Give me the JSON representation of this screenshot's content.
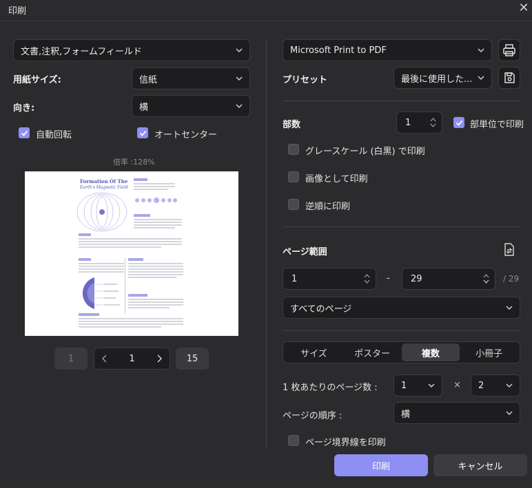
{
  "window": {
    "title": "印刷"
  },
  "left": {
    "content_select": "文書,注釈,フォームフィールド",
    "paper_size_label": "用紙サイズ:",
    "paper_size_value": "信紙",
    "orientation_label": "向き:",
    "orientation_value": "横",
    "auto_rotate_label": "自動回転",
    "auto_center_label": "オートセンター",
    "zoom_label": "倍率 :128%",
    "preview": {
      "title_line1": "Formation Of The",
      "title_line2": "Earth's Magnetic Field"
    },
    "pager": {
      "first": "1",
      "current": "1",
      "last": "15"
    }
  },
  "right": {
    "printer_value": "Microsoft Print to PDF",
    "preset_label": "プリセット",
    "preset_value": "最後に使用した...",
    "copies_label": "部数",
    "copies_value": "1",
    "collate_label": "部単位で印刷",
    "grayscale_label": "グレースケール (白黒) で印刷",
    "as_image_label": "画像として印刷",
    "reverse_label": "逆順に印刷",
    "page_range_label": "ページ範囲",
    "range_from": "1",
    "range_dash": "-",
    "range_to": "29",
    "range_total": "/ 29",
    "range_select": "すべてのページ",
    "tabs": [
      "サイズ",
      "ポスター",
      "複数",
      "小冊子"
    ],
    "active_tab": "複数",
    "pages_per_sheet_label": "1 枚あたりのページ数 :",
    "pages_per_sheet_a": "1",
    "times": "×",
    "pages_per_sheet_b": "2",
    "page_order_label": "ページの順序 :",
    "page_order_value": "横",
    "print_border_label": "ページ境界線を印刷"
  },
  "buttons": {
    "print": "印刷",
    "cancel": "キャンセル"
  },
  "colors": {
    "accent": "#8f8ef2",
    "background": "#2b2b2d",
    "field": "#1d1d1f"
  }
}
